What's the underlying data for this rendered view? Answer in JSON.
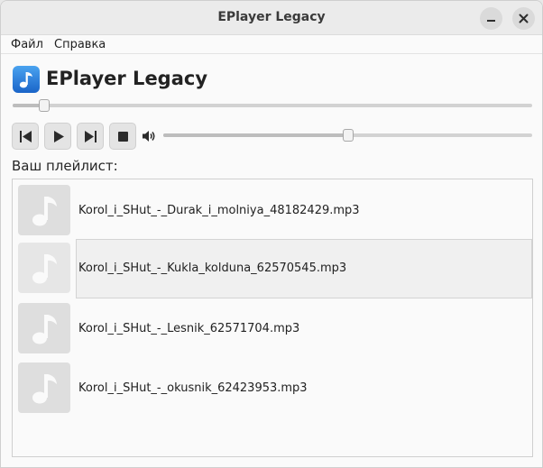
{
  "window": {
    "title": "EPlayer Legacy"
  },
  "menubar": {
    "items": [
      {
        "label": "Файл"
      },
      {
        "label": "Справка"
      }
    ]
  },
  "app": {
    "title": "EPlayer Legacy",
    "accent": "#1e6fd9"
  },
  "seek": {
    "progress_fraction": 0.06
  },
  "volume": {
    "level_fraction": 0.5
  },
  "controls": [
    {
      "icon": "skip-previous-icon"
    },
    {
      "icon": "play-icon"
    },
    {
      "icon": "skip-next-icon"
    },
    {
      "icon": "stop-icon"
    }
  ],
  "playlist": {
    "label": "Ваш плейлист:",
    "tracks": [
      {
        "name": "Korol_i_SHut_-_Durak_i_molniya_48182429.mp3",
        "selected": false
      },
      {
        "name": "Korol_i_SHut_-_Kukla_kolduna_62570545.mp3",
        "selected": true
      },
      {
        "name": "Korol_i_SHut_-_Lesnik_62571704.mp3",
        "selected": false
      },
      {
        "name": "Korol_i_SHut_-_okusnik_62423953.mp3",
        "selected": false
      }
    ]
  }
}
